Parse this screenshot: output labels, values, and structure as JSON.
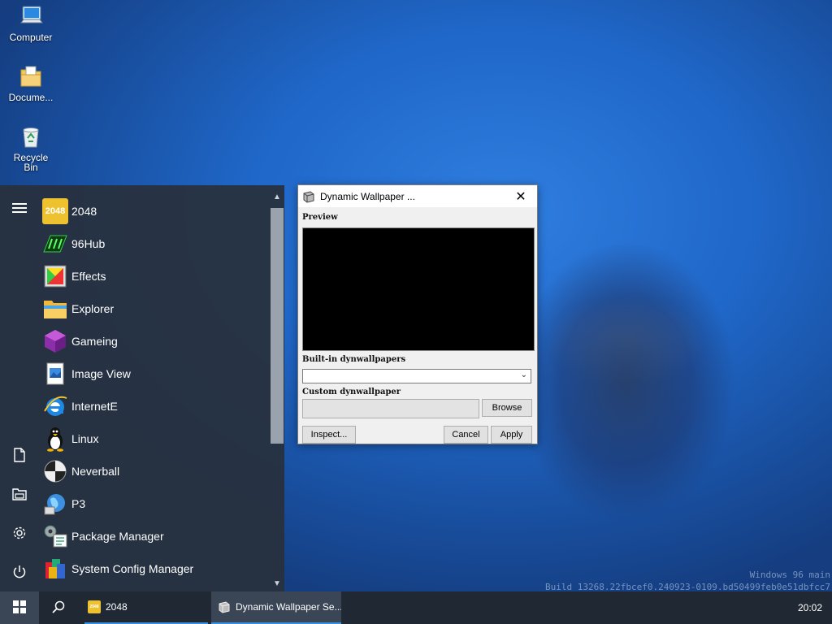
{
  "desktop": {
    "icons": [
      {
        "label": "Computer",
        "icon": "computer-icon"
      },
      {
        "label": "Docume...",
        "icon": "documents-folder-icon"
      },
      {
        "label": "Recycle Bin",
        "icon": "recycle-bin-icon"
      }
    ],
    "watermark": {
      "line1": "Windows 96 main",
      "line2": "Build 13268.22fbcef0.240923-0109.bd50499feb0e51dbfcc7"
    }
  },
  "start_menu": {
    "side_icons": [
      "hamburger-menu-icon",
      "document-icon",
      "folder-icon",
      "gear-icon",
      "power-icon"
    ],
    "apps": [
      {
        "label": "2048",
        "icon": "2048-icon"
      },
      {
        "label": "96Hub",
        "icon": "96hub-icon"
      },
      {
        "label": "Effects",
        "icon": "effects-icon"
      },
      {
        "label": "Explorer",
        "icon": "explorer-folder-icon"
      },
      {
        "label": "Gameing",
        "icon": "gameing-cube-icon"
      },
      {
        "label": "Image View",
        "icon": "image-view-icon"
      },
      {
        "label": "InternetE",
        "icon": "internet-explorer-icon"
      },
      {
        "label": "Linux",
        "icon": "tux-penguin-icon"
      },
      {
        "label": "Neverball",
        "icon": "neverball-icon"
      },
      {
        "label": "P3",
        "icon": "globe-icon"
      },
      {
        "label": "Package Manager",
        "icon": "package-manager-icon"
      },
      {
        "label": "System Config Manager",
        "icon": "system-config-icon"
      }
    ],
    "icon_2048_text": "2048"
  },
  "dialog": {
    "title": "Dynamic Wallpaper ...",
    "preview_label": "Preview",
    "builtin_label": "Built-in dynwallpapers",
    "builtin_selected": "",
    "custom_label": "Custom dynwallpaper",
    "custom_value": "",
    "browse_label": "Browse",
    "inspect_label": "Inspect...",
    "cancel_label": "Cancel",
    "apply_label": "Apply"
  },
  "taskbar": {
    "tasks": [
      {
        "label": "2048",
        "icon": "2048-icon",
        "accent": "#3a8fe0"
      },
      {
        "label": "Dynamic Wallpaper Se...",
        "icon": "dynamic-wallpaper-icon",
        "accent": "#3a8fe0"
      }
    ],
    "clock": "20:02"
  },
  "colors": {
    "taskbar_bg": "#202833",
    "start_menu_bg": "#28303c",
    "accent_2048": "#edc22e"
  }
}
